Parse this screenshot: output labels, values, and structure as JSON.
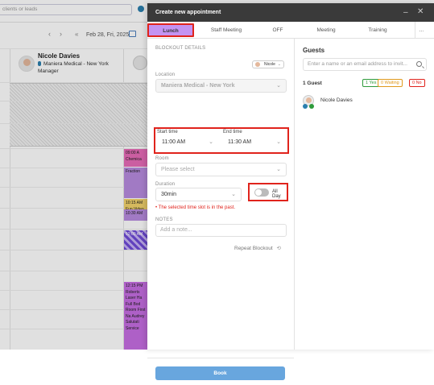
{
  "background": {
    "search_placeholder": "clients or leads",
    "date_label": "Feb 28, Fri, 2025",
    "staff": {
      "name": "Nicole Davies",
      "location": "Maniera Medical - New York",
      "role": "Manager"
    },
    "appointments": [
      {
        "text": "09:00 A Chemica"
      },
      {
        "text": "Fraction"
      },
      {
        "text": "10:15 AM Fun Video"
      },
      {
        "text": "10:30 AM"
      },
      {
        "text": "12:00 AM"
      },
      {
        "text": "12:15 PM Roberts Laser Ha Full Bod Room First Na Audrey Salutati Service"
      }
    ]
  },
  "modal": {
    "title": "Create new appointment",
    "tabs": [
      "Lunch",
      "Staff Meeting",
      "OFF",
      "Meeting",
      "Training"
    ],
    "active_tab": 0,
    "more_icon": "...",
    "section_title": "BLOCKOUT DETAILS",
    "staff_chip": "Nicole",
    "location_label": "Location",
    "location_value": "Maniera Medical - New York",
    "start_label": "Start time",
    "start_value": "11:00 AM",
    "end_label": "End time",
    "end_value": "11:30 AM",
    "room_label": "Room",
    "room_placeholder": "Please select",
    "duration_label": "Duration",
    "duration_value": "30min",
    "all_day_label": "All Day",
    "all_day_on": false,
    "error_text": "The selected time slot is in the past.",
    "notes_label": "NOTES",
    "notes_placeholder": "Add a note...",
    "repeat_label": "Repeat Blockout",
    "book_label": "Book"
  },
  "guests": {
    "title": "Guests",
    "input_placeholder": "Enter a name or an email address to invit...",
    "count_label": "1 Guest",
    "badges": {
      "yes": "1 Yes",
      "waiting": "0 Waiting",
      "no": "0 No"
    },
    "list": [
      {
        "name": "Nicole Davies"
      }
    ]
  },
  "colors": {
    "header_bg": "#3a3a3a",
    "active_tab": "#c493f2",
    "highlight": "#e0231c",
    "book_button": "#68a6de"
  }
}
